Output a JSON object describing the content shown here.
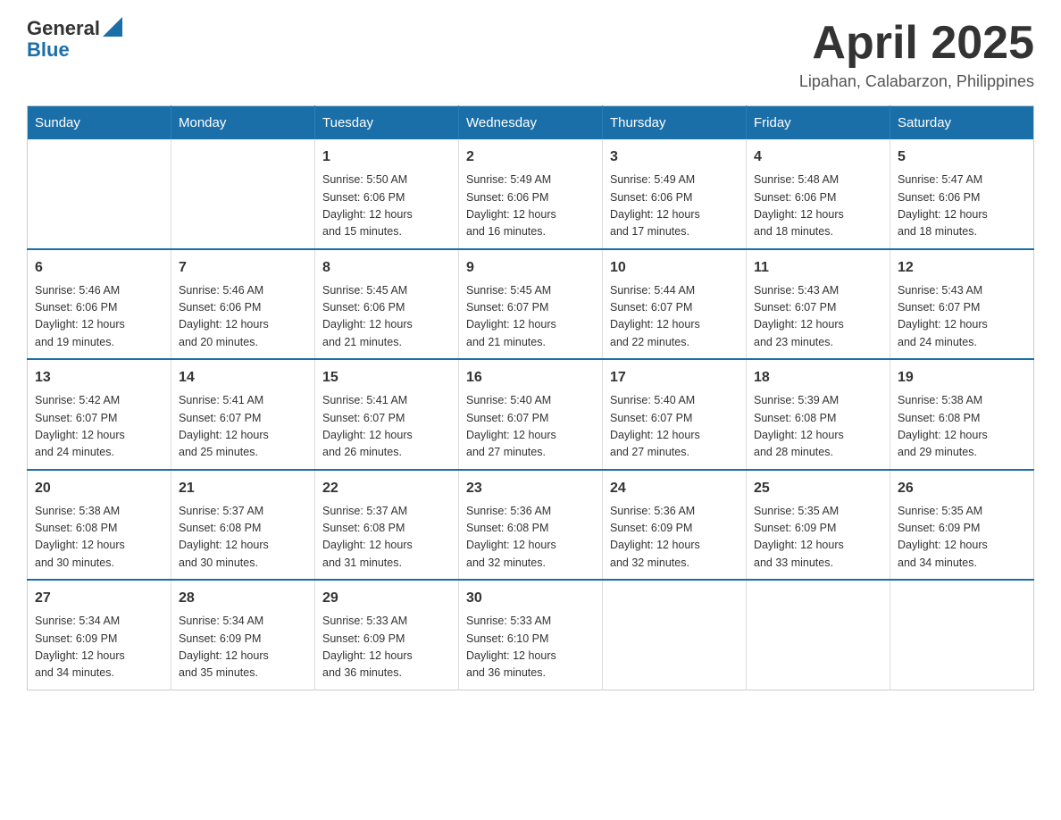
{
  "header": {
    "logo_general": "General",
    "logo_blue": "Blue",
    "month_title": "April 2025",
    "location": "Lipahan, Calabarzon, Philippines"
  },
  "calendar": {
    "days_of_week": [
      "Sunday",
      "Monday",
      "Tuesday",
      "Wednesday",
      "Thursday",
      "Friday",
      "Saturday"
    ],
    "weeks": [
      [
        {
          "day": "",
          "info": ""
        },
        {
          "day": "",
          "info": ""
        },
        {
          "day": "1",
          "info": "Sunrise: 5:50 AM\nSunset: 6:06 PM\nDaylight: 12 hours\nand 15 minutes."
        },
        {
          "day": "2",
          "info": "Sunrise: 5:49 AM\nSunset: 6:06 PM\nDaylight: 12 hours\nand 16 minutes."
        },
        {
          "day": "3",
          "info": "Sunrise: 5:49 AM\nSunset: 6:06 PM\nDaylight: 12 hours\nand 17 minutes."
        },
        {
          "day": "4",
          "info": "Sunrise: 5:48 AM\nSunset: 6:06 PM\nDaylight: 12 hours\nand 18 minutes."
        },
        {
          "day": "5",
          "info": "Sunrise: 5:47 AM\nSunset: 6:06 PM\nDaylight: 12 hours\nand 18 minutes."
        }
      ],
      [
        {
          "day": "6",
          "info": "Sunrise: 5:46 AM\nSunset: 6:06 PM\nDaylight: 12 hours\nand 19 minutes."
        },
        {
          "day": "7",
          "info": "Sunrise: 5:46 AM\nSunset: 6:06 PM\nDaylight: 12 hours\nand 20 minutes."
        },
        {
          "day": "8",
          "info": "Sunrise: 5:45 AM\nSunset: 6:06 PM\nDaylight: 12 hours\nand 21 minutes."
        },
        {
          "day": "9",
          "info": "Sunrise: 5:45 AM\nSunset: 6:07 PM\nDaylight: 12 hours\nand 21 minutes."
        },
        {
          "day": "10",
          "info": "Sunrise: 5:44 AM\nSunset: 6:07 PM\nDaylight: 12 hours\nand 22 minutes."
        },
        {
          "day": "11",
          "info": "Sunrise: 5:43 AM\nSunset: 6:07 PM\nDaylight: 12 hours\nand 23 minutes."
        },
        {
          "day": "12",
          "info": "Sunrise: 5:43 AM\nSunset: 6:07 PM\nDaylight: 12 hours\nand 24 minutes."
        }
      ],
      [
        {
          "day": "13",
          "info": "Sunrise: 5:42 AM\nSunset: 6:07 PM\nDaylight: 12 hours\nand 24 minutes."
        },
        {
          "day": "14",
          "info": "Sunrise: 5:41 AM\nSunset: 6:07 PM\nDaylight: 12 hours\nand 25 minutes."
        },
        {
          "day": "15",
          "info": "Sunrise: 5:41 AM\nSunset: 6:07 PM\nDaylight: 12 hours\nand 26 minutes."
        },
        {
          "day": "16",
          "info": "Sunrise: 5:40 AM\nSunset: 6:07 PM\nDaylight: 12 hours\nand 27 minutes."
        },
        {
          "day": "17",
          "info": "Sunrise: 5:40 AM\nSunset: 6:07 PM\nDaylight: 12 hours\nand 27 minutes."
        },
        {
          "day": "18",
          "info": "Sunrise: 5:39 AM\nSunset: 6:08 PM\nDaylight: 12 hours\nand 28 minutes."
        },
        {
          "day": "19",
          "info": "Sunrise: 5:38 AM\nSunset: 6:08 PM\nDaylight: 12 hours\nand 29 minutes."
        }
      ],
      [
        {
          "day": "20",
          "info": "Sunrise: 5:38 AM\nSunset: 6:08 PM\nDaylight: 12 hours\nand 30 minutes."
        },
        {
          "day": "21",
          "info": "Sunrise: 5:37 AM\nSunset: 6:08 PM\nDaylight: 12 hours\nand 30 minutes."
        },
        {
          "day": "22",
          "info": "Sunrise: 5:37 AM\nSunset: 6:08 PM\nDaylight: 12 hours\nand 31 minutes."
        },
        {
          "day": "23",
          "info": "Sunrise: 5:36 AM\nSunset: 6:08 PM\nDaylight: 12 hours\nand 32 minutes."
        },
        {
          "day": "24",
          "info": "Sunrise: 5:36 AM\nSunset: 6:09 PM\nDaylight: 12 hours\nand 32 minutes."
        },
        {
          "day": "25",
          "info": "Sunrise: 5:35 AM\nSunset: 6:09 PM\nDaylight: 12 hours\nand 33 minutes."
        },
        {
          "day": "26",
          "info": "Sunrise: 5:35 AM\nSunset: 6:09 PM\nDaylight: 12 hours\nand 34 minutes."
        }
      ],
      [
        {
          "day": "27",
          "info": "Sunrise: 5:34 AM\nSunset: 6:09 PM\nDaylight: 12 hours\nand 34 minutes."
        },
        {
          "day": "28",
          "info": "Sunrise: 5:34 AM\nSunset: 6:09 PM\nDaylight: 12 hours\nand 35 minutes."
        },
        {
          "day": "29",
          "info": "Sunrise: 5:33 AM\nSunset: 6:09 PM\nDaylight: 12 hours\nand 36 minutes."
        },
        {
          "day": "30",
          "info": "Sunrise: 5:33 AM\nSunset: 6:10 PM\nDaylight: 12 hours\nand 36 minutes."
        },
        {
          "day": "",
          "info": ""
        },
        {
          "day": "",
          "info": ""
        },
        {
          "day": "",
          "info": ""
        }
      ]
    ]
  }
}
